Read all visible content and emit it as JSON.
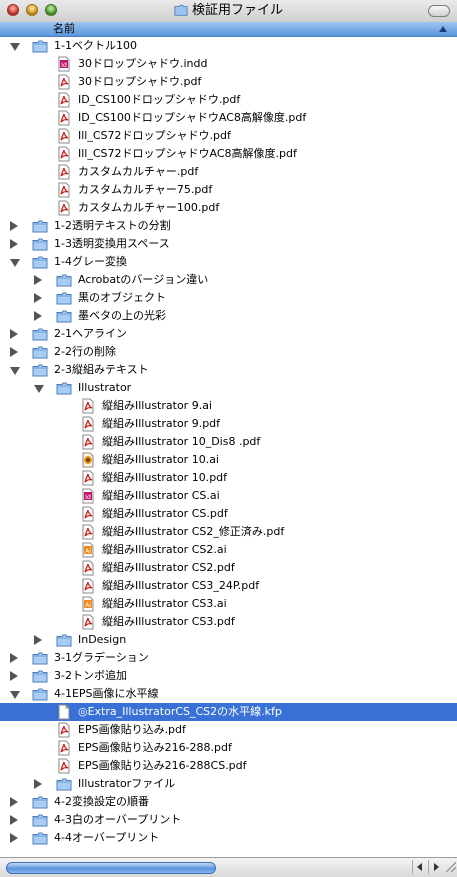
{
  "window": {
    "title": "検証用ファイル"
  },
  "header": {
    "name_col": "名前"
  },
  "rows": [
    {
      "label": "1-1ベクトル100",
      "kind": "folder",
      "disc": "open",
      "depth": 0
    },
    {
      "label": "30ドロップシャドウ.indd",
      "kind": "indd",
      "depth": 1
    },
    {
      "label": "30ドロップシャドウ.pdf",
      "kind": "pdf",
      "depth": 1
    },
    {
      "label": "ID_CS100ドロップシャドウ.pdf",
      "kind": "pdf",
      "depth": 1
    },
    {
      "label": "ID_CS100ドロップシャドウAC8高解像度.pdf",
      "kind": "pdf",
      "depth": 1
    },
    {
      "label": "Ill_CS72ドロップシャドウ.pdf",
      "kind": "pdf",
      "depth": 1
    },
    {
      "label": "Ill_CS72ドロップシャドウAC8高解像度.pdf",
      "kind": "pdf",
      "depth": 1
    },
    {
      "label": "カスタムカルチャー.pdf",
      "kind": "pdf",
      "depth": 1
    },
    {
      "label": "カスタムカルチャー75.pdf",
      "kind": "pdf",
      "depth": 1
    },
    {
      "label": "カスタムカルチャー100.pdf",
      "kind": "pdf",
      "depth": 1
    },
    {
      "label": "1-2透明テキストの分割",
      "kind": "folder",
      "disc": "closed",
      "depth": 0
    },
    {
      "label": "1-3透明変換用スペース",
      "kind": "folder",
      "disc": "closed",
      "depth": 0
    },
    {
      "label": "1-4グレー変換",
      "kind": "folder",
      "disc": "open",
      "depth": 0
    },
    {
      "label": "Acrobatのバージョン違い",
      "kind": "folder",
      "disc": "closed",
      "depth": 1
    },
    {
      "label": "黒のオブジェクト",
      "kind": "folder",
      "disc": "closed",
      "depth": 1
    },
    {
      "label": "墨ベタの上の光彩",
      "kind": "folder",
      "disc": "closed",
      "depth": 1
    },
    {
      "label": "2-1ヘアライン",
      "kind": "folder",
      "disc": "closed",
      "depth": 0
    },
    {
      "label": "2-2行の削除",
      "kind": "folder",
      "disc": "closed",
      "depth": 0
    },
    {
      "label": "2-3縦組みテキスト",
      "kind": "folder",
      "disc": "open",
      "depth": 0
    },
    {
      "label": "Illustrator",
      "kind": "folder",
      "disc": "open",
      "depth": 1
    },
    {
      "label": "縦組みIllustrator 9.ai",
      "kind": "pdf",
      "depth": 2
    },
    {
      "label": "縦組みIllustrator 9.pdf",
      "kind": "pdf",
      "depth": 2
    },
    {
      "label": "縦組みIllustrator 10_Dis8 .pdf",
      "kind": "pdf",
      "depth": 2
    },
    {
      "label": "縦組みIllustrator 10.ai",
      "kind": "ai10",
      "depth": 2
    },
    {
      "label": "縦組みIllustrator 10.pdf",
      "kind": "pdf",
      "depth": 2
    },
    {
      "label": "縦組みIllustrator CS.ai",
      "kind": "indd",
      "depth": 2
    },
    {
      "label": "縦組みIllustrator CS.pdf",
      "kind": "pdf",
      "depth": 2
    },
    {
      "label": "縦組みIllustrator CS2_修正済み.pdf",
      "kind": "pdf",
      "depth": 2
    },
    {
      "label": "縦組みIllustrator CS2.ai",
      "kind": "aics",
      "depth": 2
    },
    {
      "label": "縦組みIllustrator CS2.pdf",
      "kind": "pdf",
      "depth": 2
    },
    {
      "label": "縦組みIllustrator CS3_24P.pdf",
      "kind": "pdf",
      "depth": 2
    },
    {
      "label": "縦組みIllustrator CS3.ai",
      "kind": "aics",
      "depth": 2
    },
    {
      "label": "縦組みIllustrator CS3.pdf",
      "kind": "pdf",
      "depth": 2
    },
    {
      "label": "InDesign",
      "kind": "folder",
      "disc": "closed",
      "depth": 1
    },
    {
      "label": "3-1グラデーション",
      "kind": "folder",
      "disc": "closed",
      "depth": 0
    },
    {
      "label": "3-2トンボ追加",
      "kind": "folder",
      "disc": "closed",
      "depth": 0
    },
    {
      "label": "4-1EPS画像に水平線",
      "kind": "folder",
      "disc": "open",
      "depth": 0
    },
    {
      "label": "◎Extra_IllustratorCS_CS2の水平線.kfp",
      "kind": "doc",
      "depth": 1,
      "selected": true
    },
    {
      "label": "EPS画像貼り込み.pdf",
      "kind": "pdf",
      "depth": 1
    },
    {
      "label": "EPS画像貼り込み216-288.pdf",
      "kind": "pdf",
      "depth": 1
    },
    {
      "label": "EPS画像貼り込み216-288CS.pdf",
      "kind": "pdf",
      "depth": 1
    },
    {
      "label": "Illustratorファイル",
      "kind": "folder",
      "disc": "closed",
      "depth": 1
    },
    {
      "label": "4-2変換設定の順番",
      "kind": "folder",
      "disc": "closed",
      "depth": 0
    },
    {
      "label": "4-3白のオーバープリント",
      "kind": "folder",
      "disc": "closed",
      "depth": 0
    },
    {
      "label": "4-4オーバープリント",
      "kind": "folder",
      "disc": "closed",
      "depth": 0
    }
  ],
  "colors": {
    "selection": "#3a71d6",
    "folder": "#8fbbe8",
    "pdf_red": "#c8211b"
  }
}
